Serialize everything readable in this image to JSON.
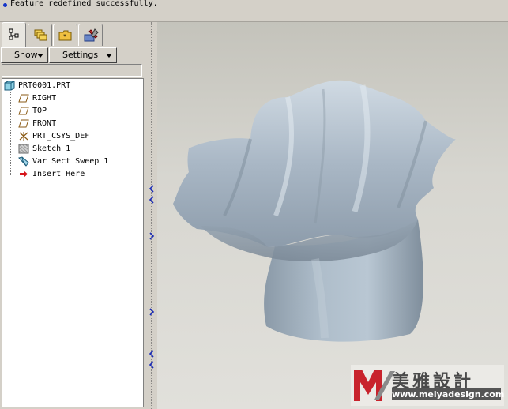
{
  "message": {
    "text": "Feature redefined successfully."
  },
  "tabs": [
    {
      "icon": "model-tree-icon",
      "active": true
    },
    {
      "icon": "layers-icon",
      "active": false
    },
    {
      "icon": "folder-icon",
      "active": false
    },
    {
      "icon": "tools-icon",
      "active": false
    }
  ],
  "panel": {
    "show_label": "Show",
    "settings_label": "Settings"
  },
  "tree": {
    "root": "PRT0001.PRT",
    "items": [
      {
        "label": "RIGHT",
        "icon": "datum-plane-icon"
      },
      {
        "label": "TOP",
        "icon": "datum-plane-icon"
      },
      {
        "label": "FRONT",
        "icon": "datum-plane-icon"
      },
      {
        "label": "PRT_CSYS_DEF",
        "icon": "coordinate-system-icon"
      },
      {
        "label": "Sketch 1",
        "icon": "sketch-icon"
      },
      {
        "label": "Var Sect Sweep 1",
        "icon": "sweep-icon"
      },
      {
        "label": "Insert Here",
        "icon": "insert-arrow-icon"
      }
    ]
  },
  "watermark": {
    "chinese": "美雅設計",
    "url": "www.meiyadesign.com"
  },
  "colors": {
    "panel_bg": "#d4d0c8",
    "model_fill": "#a7b6c4",
    "accent": "#1535c9",
    "watermark_red": "#c8232c"
  }
}
